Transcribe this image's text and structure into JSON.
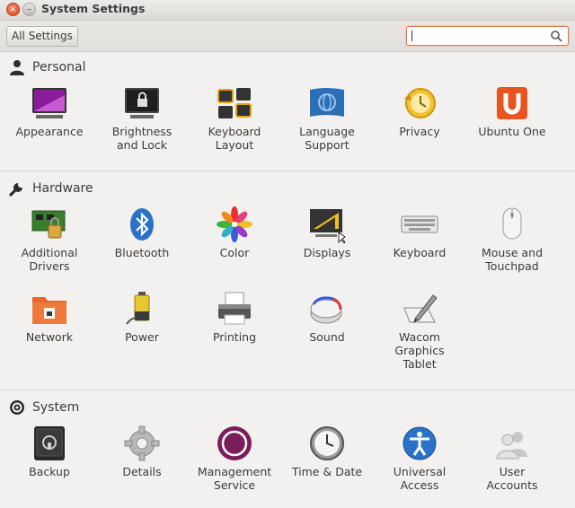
{
  "window": {
    "title": "System Settings",
    "close_glyph": "×",
    "minimize_glyph": "–"
  },
  "toolbar": {
    "all_settings_label": "All Settings",
    "search_value": "",
    "search_placeholder": ""
  },
  "sections": {
    "personal": {
      "label": "Personal",
      "icon": "person-icon",
      "items": [
        {
          "label": "Appearance",
          "icon": "appearance-icon"
        },
        {
          "label": "Brightness\nand Lock",
          "icon": "brightness-lock-icon"
        },
        {
          "label": "Keyboard\nLayout",
          "icon": "keyboard-layout-icon"
        },
        {
          "label": "Language\nSupport",
          "icon": "language-support-icon"
        },
        {
          "label": "Privacy",
          "icon": "privacy-icon"
        },
        {
          "label": "Ubuntu One",
          "icon": "ubuntu-one-icon"
        }
      ]
    },
    "hardware": {
      "label": "Hardware",
      "icon": "wrench-icon",
      "items": [
        {
          "label": "Additional\nDrivers",
          "icon": "additional-drivers-icon"
        },
        {
          "label": "Bluetooth",
          "icon": "bluetooth-icon"
        },
        {
          "label": "Color",
          "icon": "color-icon"
        },
        {
          "label": "Displays",
          "icon": "displays-icon"
        },
        {
          "label": "Keyboard",
          "icon": "keyboard-icon"
        },
        {
          "label": "Mouse and\nTouchpad",
          "icon": "mouse-touchpad-icon"
        },
        {
          "label": "Network",
          "icon": "network-icon"
        },
        {
          "label": "Power",
          "icon": "power-icon"
        },
        {
          "label": "Printing",
          "icon": "printer-icon"
        },
        {
          "label": "Sound",
          "icon": "sound-icon"
        },
        {
          "label": "Wacom\nGraphics\nTablet",
          "icon": "wacom-tablet-icon"
        }
      ]
    },
    "system": {
      "label": "System",
      "icon": "system-gear-icon",
      "items": [
        {
          "label": "Backup",
          "icon": "backup-icon"
        },
        {
          "label": "Details",
          "icon": "details-gear-icon"
        },
        {
          "label": "Management\nService",
          "icon": "management-service-icon"
        },
        {
          "label": "Time & Date",
          "icon": "clock-icon"
        },
        {
          "label": "Universal\nAccess",
          "icon": "universal-access-icon"
        },
        {
          "label": "User\nAccounts",
          "icon": "user-accounts-icon"
        }
      ]
    }
  },
  "colors": {
    "background": "#f2f1f0",
    "accent_orange": "#e2764a",
    "ubuntu_orange": "#e95420",
    "management_purple": "#7b1d5a"
  }
}
